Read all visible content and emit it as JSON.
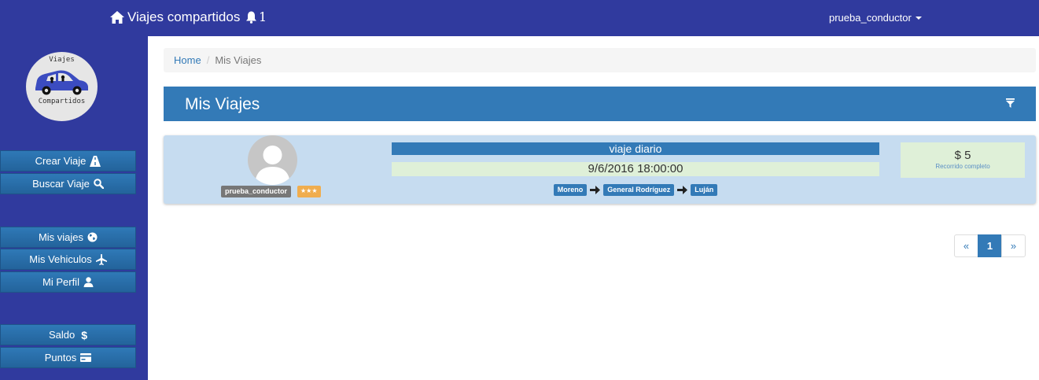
{
  "navbar": {
    "brand": "Viajes compartidos",
    "notification_count": "1",
    "username": "prueba_conductor"
  },
  "logo": {
    "top_text": "Viajes",
    "bottom_text": "Compartidos"
  },
  "sidebar": {
    "group1": [
      {
        "label": "Crear Viaje",
        "icon": "road-icon"
      },
      {
        "label": "Buscar Viaje",
        "icon": "search-icon"
      }
    ],
    "group2": [
      {
        "label": "Mis viajes",
        "icon": "globe-icon"
      },
      {
        "label": "Mis Vehiculos",
        "icon": "plane-icon"
      },
      {
        "label": "Mi Perfil",
        "icon": "user-icon"
      }
    ],
    "group3": [
      {
        "label": "Saldo",
        "icon": "dollar-icon"
      },
      {
        "label": "Puntos",
        "icon": "credit-card-icon"
      }
    ]
  },
  "breadcrumb": {
    "home": "Home",
    "separator": "/",
    "current": "Mis Viajes"
  },
  "page": {
    "title": "Mis Viajes"
  },
  "trips": [
    {
      "driver": "prueba_conductor",
      "rating": "★★★",
      "name": "viaje diario",
      "datetime": "9/6/2016 18:00:00",
      "route": [
        "Moreno",
        "General Rodríguez",
        "Luján"
      ],
      "price": "$ 5",
      "price_note": "Recorrido completo"
    }
  ],
  "pagination": {
    "prev": "«",
    "current": "1",
    "next": "»"
  },
  "colors": {
    "navbar": "#303a9e",
    "primary": "#337ab7",
    "card": "#c6dcf0",
    "success_bg": "#dff0d8",
    "warning": "#f0ad4e"
  }
}
